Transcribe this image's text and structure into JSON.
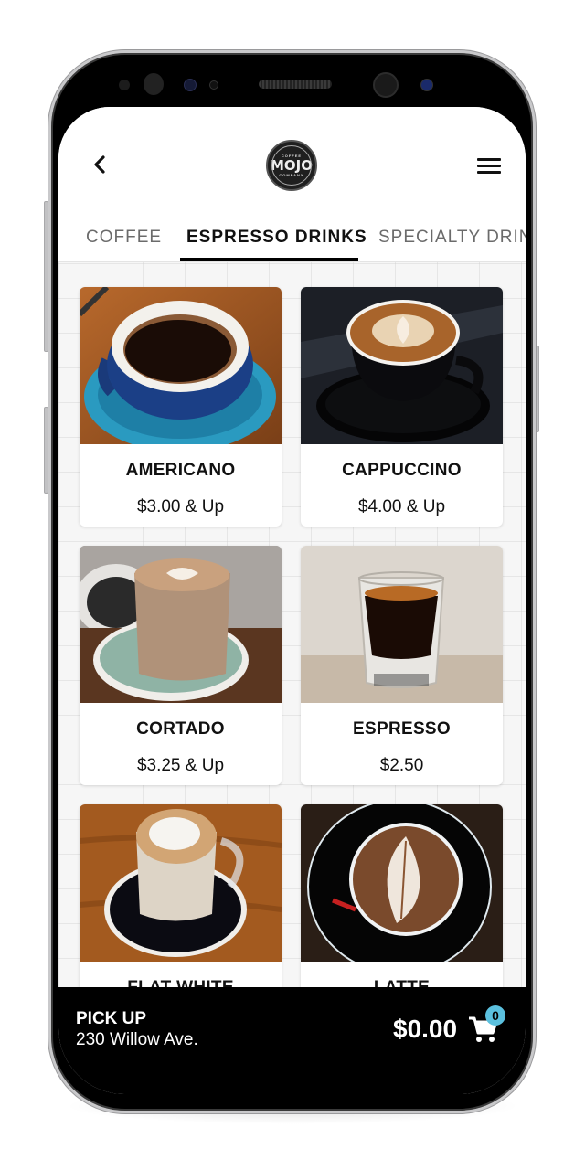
{
  "header": {
    "back_label": "Back",
    "menu_label": "Menu",
    "logo": {
      "top_text": "COFFEE",
      "main_text": "MOJO",
      "bottom_text": "COMPANY"
    }
  },
  "tabs": [
    {
      "label": "COFFEE",
      "active": false
    },
    {
      "label": "ESPRESSO DRINKS",
      "active": true
    },
    {
      "label": "SPECIALTY DRIN",
      "active": false
    }
  ],
  "products": [
    {
      "name": "AMERICANO",
      "price": "$3.00 & Up",
      "image": "americano-blue-cup"
    },
    {
      "name": "CAPPUCCINO",
      "price": "$4.00 & Up",
      "image": "cappuccino-black-cup"
    },
    {
      "name": "CORTADO",
      "price": "$3.25 & Up",
      "image": "cortado-glass"
    },
    {
      "name": "ESPRESSO",
      "price": "$2.50",
      "image": "espresso-shot-glass"
    },
    {
      "name": "FLAT WHITE",
      "price": "",
      "image": "flat-white-glass"
    },
    {
      "name": "LATTE",
      "price": "",
      "image": "latte-art-black-cup"
    }
  ],
  "bottom_bar": {
    "pickup_label": "PICK UP",
    "pickup_address": "230 Willow Ave.",
    "total": "$0.00",
    "cart_count": "0"
  },
  "colors": {
    "accent_badge": "#5bc0de",
    "tab_active": "#111111",
    "tab_inactive": "#6b6b6b",
    "bar_bg": "#000000"
  }
}
